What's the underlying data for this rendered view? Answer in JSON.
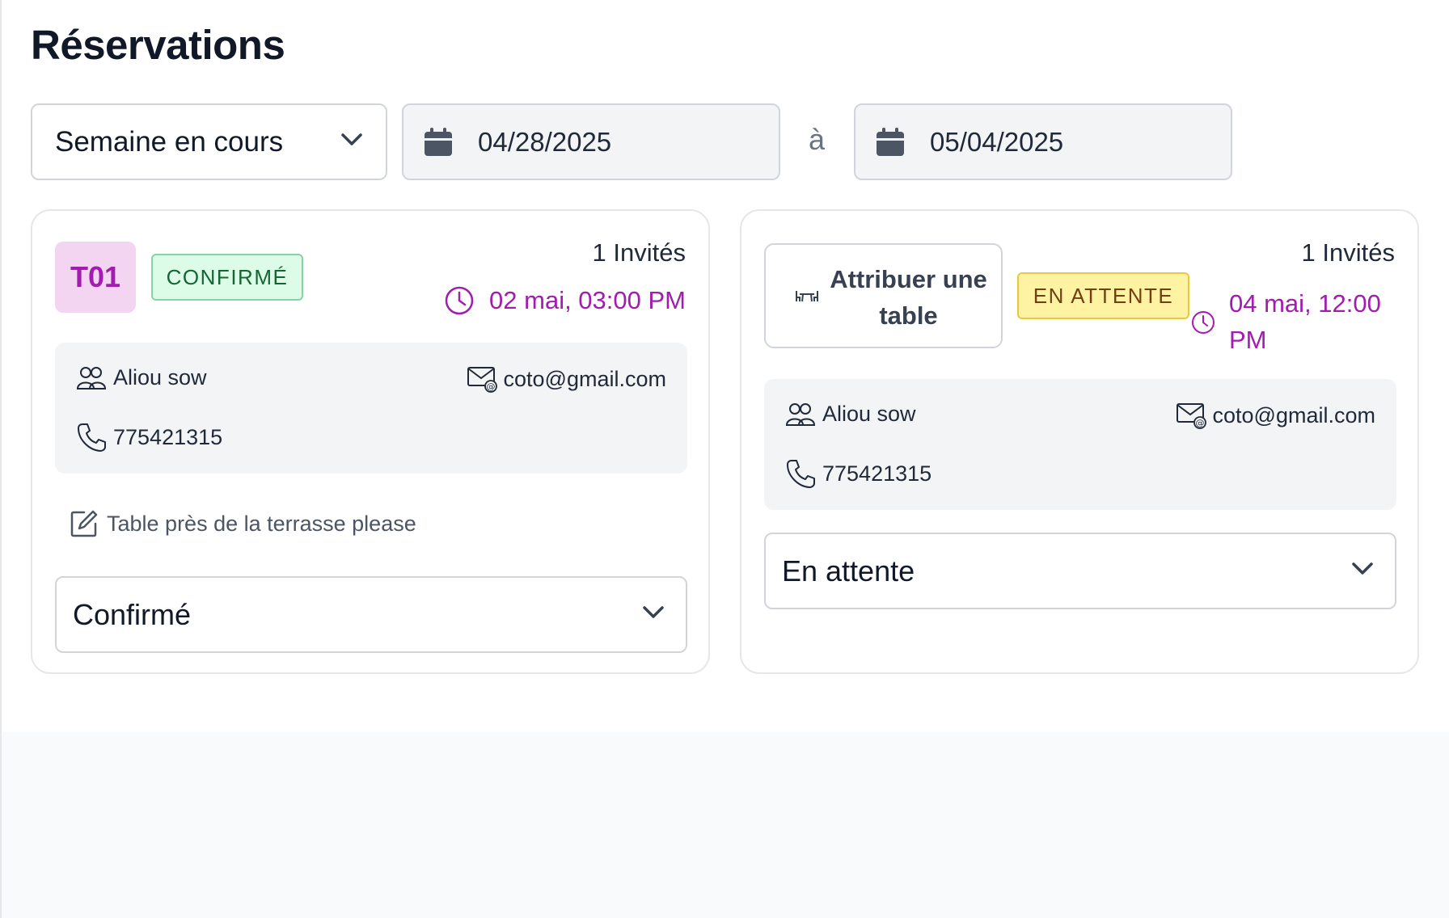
{
  "page": {
    "title": "Réservations"
  },
  "filters": {
    "period": "Semaine en cours",
    "date_from": "04/28/2025",
    "separator": "à",
    "date_to": "05/04/2025"
  },
  "reservations": [
    {
      "table": "T01",
      "status_badge": "CONFIRMÉ",
      "guests": "1 Invités",
      "datetime": "02 mai, 03:00 PM",
      "name": "Aliou sow",
      "email": "coto@gmail.com",
      "phone": "775421315",
      "note": "Table près de la terrasse please",
      "status_value": "Confirmé"
    },
    {
      "assign_label": "Attribuer une table",
      "status_badge": "EN ATTENTE",
      "guests": "1 Invités",
      "datetime": "04 mai, 12:00 PM",
      "name": "Aliou sow",
      "email": "coto@gmail.com",
      "phone": "775421315",
      "status_value": "En attente"
    }
  ],
  "colors": {
    "accent": "#a21caf",
    "confirmed_bg": "#dcfce7",
    "pending_bg": "#fef3a3"
  }
}
